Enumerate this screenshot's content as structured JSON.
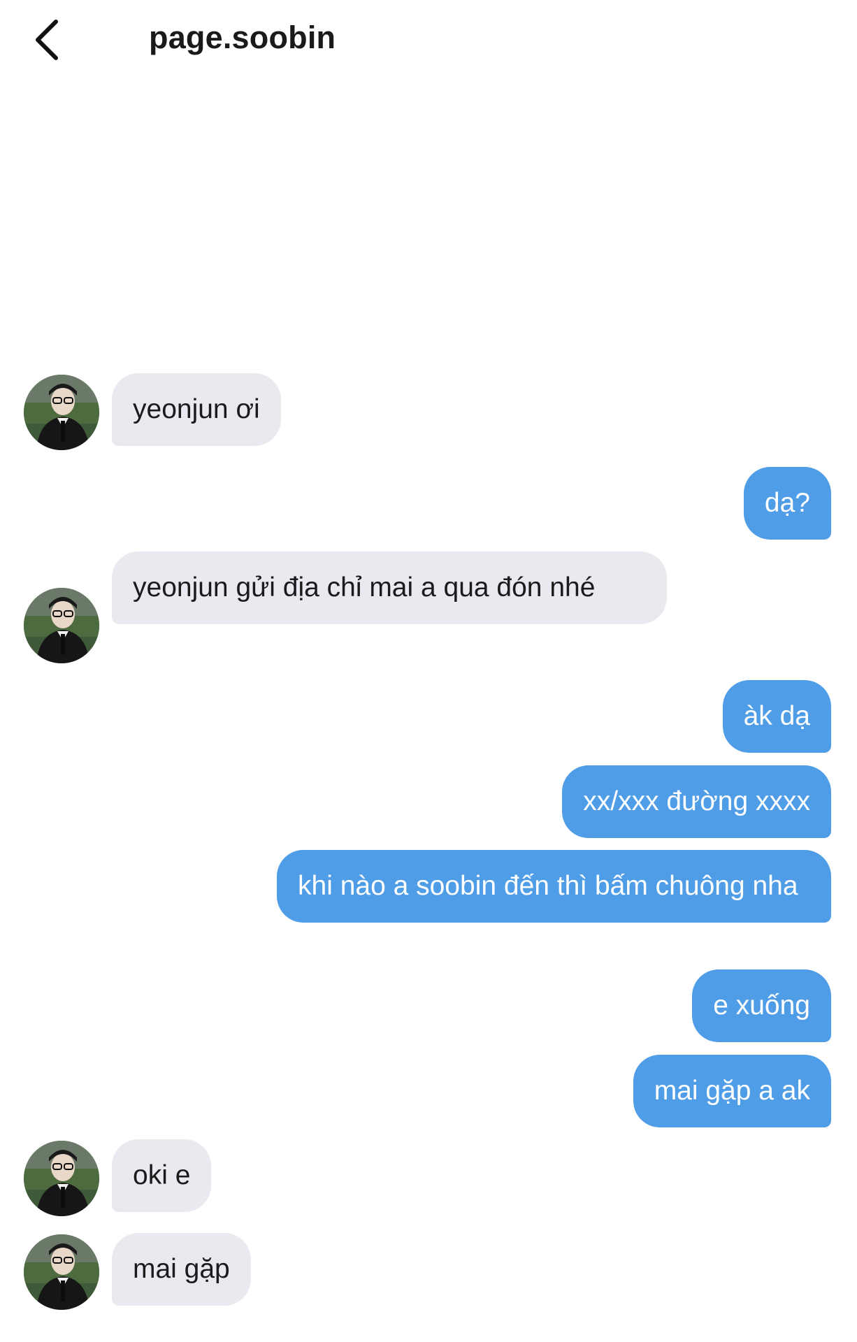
{
  "header": {
    "title": "page.soobin",
    "back_icon": "chevron-left-icon"
  },
  "colors": {
    "incoming_bubble": "#e8eaf0",
    "outgoing_bubble": "#4f9de7",
    "outgoing_text": "#ffffff"
  },
  "messages": [
    {
      "sender": "soobin",
      "text": "yeonjun ơi"
    },
    {
      "sender": "me",
      "text": "dạ?"
    },
    {
      "sender": "soobin",
      "text": "yeonjun gửi địa chỉ mai a qua đón nhé"
    },
    {
      "sender": "me",
      "text": "àk dạ"
    },
    {
      "sender": "me",
      "text": "xx/xxx đường xxxx"
    },
    {
      "sender": "me",
      "text": "khi nào a soobin đến thì bấm chuông nha"
    },
    {
      "sender": "me",
      "text": "e xuống"
    },
    {
      "sender": "me",
      "text": "mai gặp a ak"
    },
    {
      "sender": "soobin",
      "text": "oki e"
    },
    {
      "sender": "soobin",
      "text": "mai gặp"
    }
  ]
}
